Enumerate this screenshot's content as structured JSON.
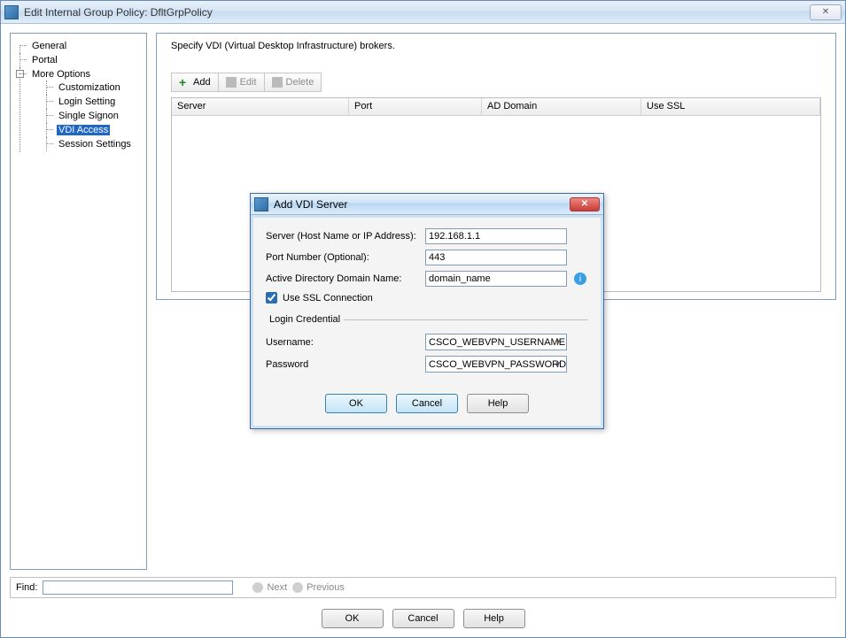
{
  "window": {
    "title": "Edit Internal Group Policy: DfltGrpPolicy"
  },
  "tree": {
    "general": "General",
    "portal": "Portal",
    "more_options": "More Options",
    "customization": "Customization",
    "login_setting": "Login Setting",
    "single_signon": "Single Signon",
    "vdi_access": "VDI Access",
    "session_settings": "Session Settings"
  },
  "content": {
    "desc": "Specify VDI (Virtual Desktop Infrastructure) brokers."
  },
  "toolbar": {
    "add": "Add",
    "edit": "Edit",
    "delete": "Delete"
  },
  "grid": {
    "cols": {
      "server": "Server",
      "port": "Port",
      "ad_domain": "AD Domain",
      "use_ssl": "Use SSL"
    }
  },
  "find": {
    "label": "Find:",
    "value": "",
    "next": "Next",
    "previous": "Previous"
  },
  "buttons": {
    "ok": "OK",
    "cancel": "Cancel",
    "help": "Help"
  },
  "modal": {
    "title": "Add VDI Server",
    "server_label": "Server (Host Name or IP Address):",
    "server_value": "192.168.1.1",
    "port_label": "Port Number (Optional):",
    "port_value": "443",
    "addom_label": "Active Directory Domain Name:",
    "addom_value": "domain_name",
    "use_ssl_label": "Use SSL Connection",
    "use_ssl_checked": true,
    "login_legend": "Login Credential",
    "username_label": "Username:",
    "username_value": "CSCO_WEBVPN_USERNAME",
    "password_label": "Password",
    "password_value": "CSCO_WEBVPN_PASSWORD",
    "ok": "OK",
    "cancel": "Cancel",
    "help": "Help"
  }
}
